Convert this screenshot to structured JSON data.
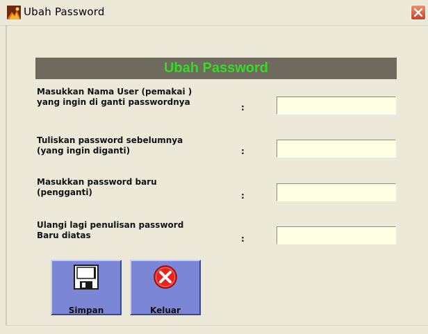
{
  "window": {
    "title": "Ubah Password"
  },
  "form": {
    "header": "Ubah Password",
    "fields": [
      {
        "label_line1": "Masukkan Nama User (pemakai )",
        "label_line2": "yang ingin di ganti passwordnya",
        "colon": ":",
        "value": ""
      },
      {
        "label_line1": "Tuliskan password sebelumnya",
        "label_line2": "(yang ingin diganti)",
        "colon": ":",
        "value": ""
      },
      {
        "label_line1": "Masukkan password baru",
        "label_line2": "(pengganti)",
        "colon": ":",
        "value": ""
      },
      {
        "label_line1": "Ulangi  lagi penulisan password",
        "label_line2": "Baru diatas",
        "colon": ":",
        "value": ""
      }
    ]
  },
  "buttons": {
    "save": {
      "label": "Simpan",
      "icon": "floppy-disk-icon"
    },
    "exit": {
      "label": "Keluar",
      "icon": "red-x-icon"
    }
  },
  "colors": {
    "window_bg": "#ECE9D8",
    "header_bg": "#6E6A5D",
    "header_text": "#33DD22",
    "button_bg": "#7B86D6",
    "field_bg": "#FEFEE2",
    "close_red": "#D9512C"
  }
}
